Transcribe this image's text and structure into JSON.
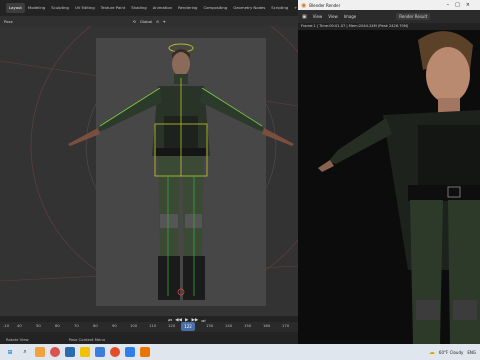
{
  "workspace_tabs": [
    "Layout",
    "Modeling",
    "Sculpting",
    "UV Editing",
    "Texture Paint",
    "Shading",
    "Animation",
    "Rendering",
    "Compositing",
    "Geometry Nodes",
    "Scripting",
    "+"
  ],
  "toolbar": {
    "mode": "Pose",
    "transform": "Global"
  },
  "timeline": {
    "ticks": [
      "-10",
      "40",
      "50",
      "60",
      "70",
      "80",
      "90",
      "100",
      "110",
      "120",
      "130",
      "140",
      "150",
      "160",
      "170",
      "180"
    ],
    "current_frame": "122"
  },
  "status": {
    "item1": "Rotate View",
    "item2": "Pose Context Menu"
  },
  "render_window": {
    "title": "Blender Render",
    "menu": [
      "View",
      "View",
      "Image"
    ],
    "slot_label": "Render Result",
    "info": "Frame:1 | Time:00:01.07 | Mem:2044.24M (Peak 2426.70M)"
  },
  "taskbar": {
    "weather": "60°F  Cloudy",
    "lang": "ENG"
  }
}
